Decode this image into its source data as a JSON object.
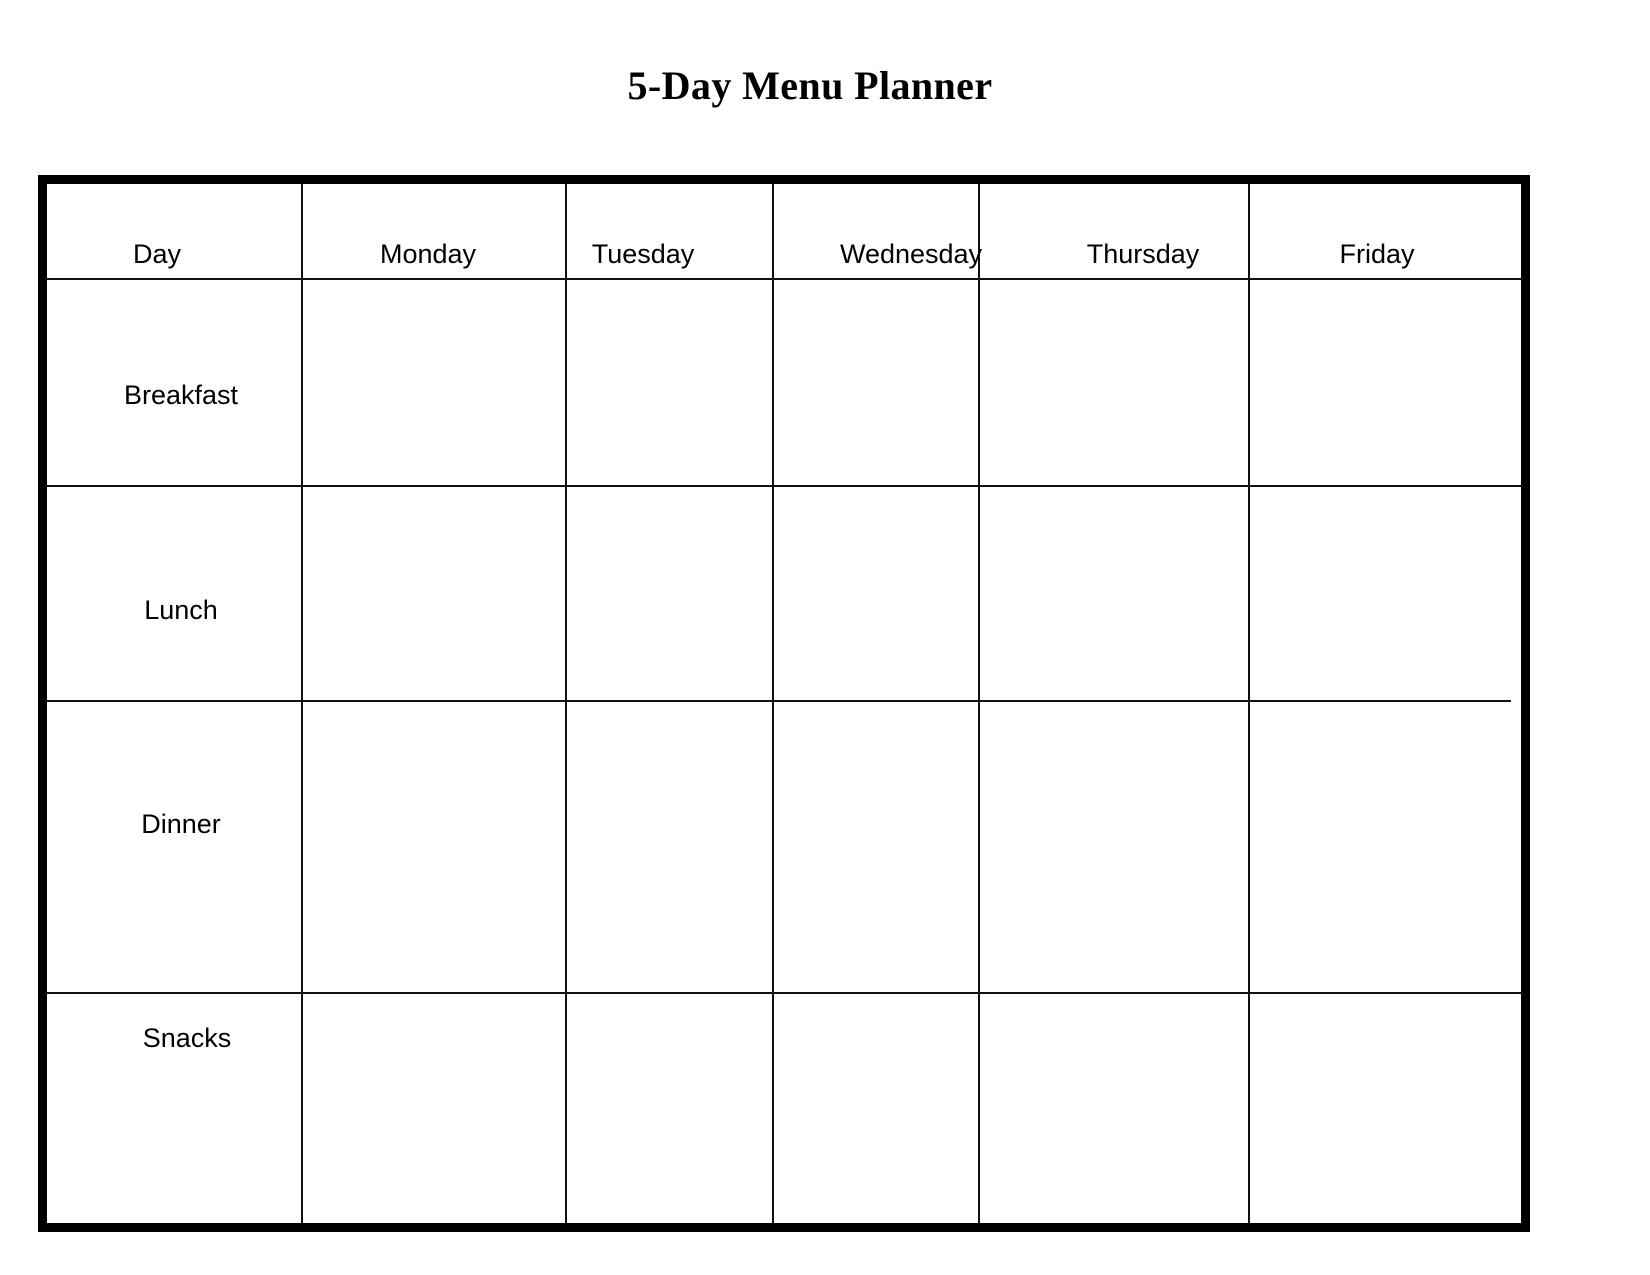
{
  "document": {
    "title": "5-Day Menu Planner",
    "background_color": "#ffffff",
    "text_color": "#000000",
    "border_color": "#000000"
  },
  "table": {
    "columns": [
      {
        "key": "day",
        "label": "Day"
      },
      {
        "key": "monday",
        "label": "Monday"
      },
      {
        "key": "tuesday",
        "label": "Tuesday"
      },
      {
        "key": "wednesday",
        "label": "Wednesday"
      },
      {
        "key": "thursday",
        "label": "Thursday"
      },
      {
        "key": "friday",
        "label": "Friday"
      }
    ],
    "rows": [
      {
        "label": "Breakfast",
        "cells": {
          "monday": "",
          "tuesday": "",
          "wednesday": "",
          "thursday": "",
          "friday": ""
        }
      },
      {
        "label": "Lunch",
        "cells": {
          "monday": "",
          "tuesday": "",
          "wednesday": "",
          "thursday": "",
          "friday": ""
        }
      },
      {
        "label": "Dinner",
        "cells": {
          "monday": "",
          "tuesday": "",
          "wednesday": "",
          "thursday": "",
          "friday": ""
        }
      },
      {
        "label": "Snacks",
        "cells": {
          "monday": "",
          "tuesday": "",
          "wednesday": "",
          "thursday": "",
          "friday": ""
        }
      }
    ]
  }
}
